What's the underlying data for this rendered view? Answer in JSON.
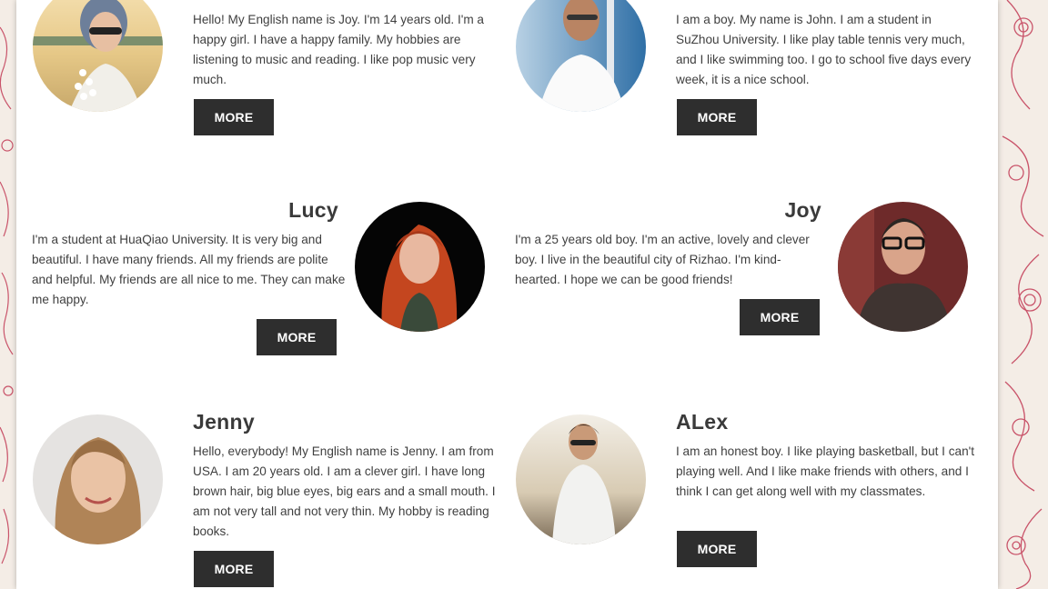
{
  "profiles": [
    {
      "name": "",
      "bio": "Hello! My English name is Joy. I'm 14 years old. I'm a happy girl. I have a happy family. My hobbies are listening to music and reading. I like pop music very much.",
      "button": "MORE"
    },
    {
      "name": "",
      "bio": "I am a boy. My name is John. I am a student in SuZhou University. I like play table tennis very much, and I like swimming too. I go to school five days every week, it is a nice school.",
      "button": "MORE"
    },
    {
      "name": "Lucy",
      "bio": "I'm a student at HuaQiao University. It is very big and beautiful. I have many friends. All my friends are polite and helpful. My friends are all nice to me. They can make me happy.",
      "button": "MORE"
    },
    {
      "name": "Joy",
      "bio": "I'm a 25 years old boy. I'm an active, lovely and clever boy. I live in the beautiful city of Rizhao. I'm kind-hearted. I hope we can be good friends!",
      "button": "MORE"
    },
    {
      "name": "Jenny",
      "bio": "Hello, everybody! My English name is Jenny. I am from USA. I am 20 years old. I am a clever girl. I have long brown hair, big blue eyes, big ears and a small mouth. I am not very tall and not very thin. My hobby is reading books.",
      "button": "MORE"
    },
    {
      "name": "ALex",
      "bio": "I am an honest boy. I like playing basketball, but I can't playing well. And I like make friends with others, and I think I can get along well with my classmates.",
      "button": "MORE"
    }
  ],
  "colors": {
    "button_bg": "#2e2e2e",
    "button_text": "#ffffff",
    "text": "#3f3f3f",
    "pattern": "#c9546a"
  }
}
